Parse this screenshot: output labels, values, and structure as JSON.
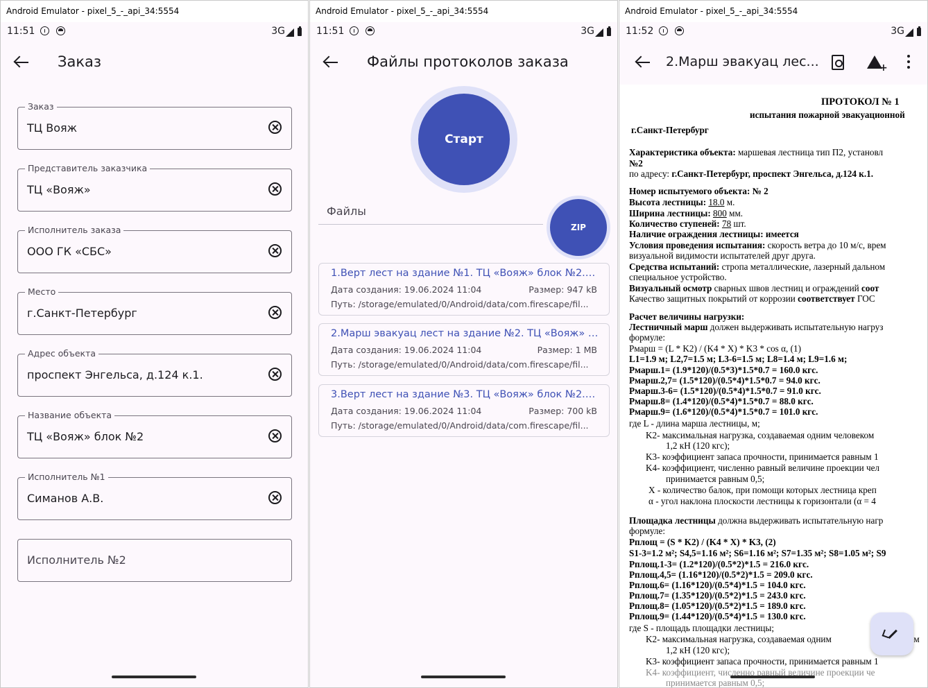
{
  "window_title": "Android Emulator - pixel_5_-_api_34:5554",
  "status": {
    "time_1": "11:51",
    "time_2": "11:51",
    "time_3": "11:52",
    "network": "3G"
  },
  "order_screen": {
    "title": "Заказ",
    "fields": [
      {
        "label": "Заказ",
        "value": "ТЦ Вояж"
      },
      {
        "label": "Представитель заказчика",
        "value": "ТЦ «Вояж»"
      },
      {
        "label": "Исполнитель заказа",
        "value": "ООО ГК «СБС»"
      },
      {
        "label": "Место",
        "value": "г.Санкт-Петербург"
      },
      {
        "label": "Адрес объекта",
        "value": "проспект Энгельса, д.124 к.1."
      },
      {
        "label": "Название объекта",
        "value": "ТЦ «Вояж» блок №2"
      },
      {
        "label": "Исполнитель №1",
        "value": "Симанов А.В."
      }
    ],
    "empty_field_placeholder": "Исполнитель №2"
  },
  "files_screen": {
    "title": "Файлы протоколов заказа",
    "start_label": "Старт",
    "zip_label": "ZIP",
    "files_label": "Файлы",
    "files": [
      {
        "name": "1.Верт лест на здание №1. ТЦ «Вояж» блок №2.pdf",
        "date": "Дата создания: 19.06.2024 11:04",
        "size": "Размер: 947 kB",
        "path": "Путь: /storage/emulated/0/Android/data/com.firescape/fil..."
      },
      {
        "name": "2.Марш эвакуац лест на здание №2. ТЦ «Вояж» блок №2.pdf",
        "date": "Дата создания: 19.06.2024 11:04",
        "size": "Размер: 1 MB",
        "path": "Путь: /storage/emulated/0/Android/data/com.firescape/fil..."
      },
      {
        "name": "3.Верт лест на здание №3. ТЦ «Вояж» блок №2.pdf",
        "date": "Дата создания: 19.06.2024 11:04",
        "size": "Размер: 700 kB",
        "path": "Путь: /storage/emulated/0/Android/data/com.firescape/fil..."
      }
    ]
  },
  "viewer_screen": {
    "title": "2.Марш эвакуац лес...",
    "doc": {
      "h1": "ПРОТОКОЛ № 1",
      "h2": "испытания пожарной эвакуационной",
      "city": "г.Санкт-Петербург",
      "char_label": "Характеристика объекта:",
      "char_value": " маршевая лестница тип П2, установл",
      "char_no": "№2",
      "addr_label": "по адресу: ",
      "addr_value": "г.Санкт-Петербург, проспект Энгельса, д.124 к.1.",
      "num_label": "Номер испытуемого объекта: № 2",
      "height_label": "Высота лестницы: ",
      "height_value": "18.0",
      "height_unit": " м.",
      "width_label": "Ширина лестницы: ",
      "width_value": "800",
      "width_unit": " мм.",
      "steps_label": "Количество ступеней: ",
      "steps_value": "78",
      "steps_unit": " шт.",
      "fence": "Наличие ограждения лестницы: имеется",
      "cond_label": "Условия проведения испытания:",
      "cond_value": " скорость ветра до 10 м/с, врем",
      "cond_line2": "визуальной видимости испытателей друг друга.",
      "means_label": "Средства испытаний:",
      "means_value": " стропа металлические, лазерный дальном",
      "means_line2": "специальное устройство.",
      "visual_label": "Визуальный осмотр",
      "visual_value": " сварных швов лестниц и ограждений ",
      "visual_end": "соот",
      "quality": "Качество защитных покрытий от коррозии ",
      "quality_b": "соответствует",
      "quality_end": " ГОС",
      "calc_title": "Расчет величины нагрузки:",
      "march_label": "Лестничный марш",
      "march_value": " должен выдерживать испытательную нагруз",
      "formula_word": "формуле:",
      "f1": "Pмарш = (L * K2) / (K4 * X) * K3 * cos α,     (1)",
      "f1_vals": "L1=1.9 м; L2,7=1.5 м; L3-6=1.5 м; L8=1.4 м; L9=1.6 м;",
      "f1_r1": "Pмарш.1= (1.9*120)/(0.5*3)*1.5*0.7 = 160.0 кгс.",
      "f1_r2": "Pмарш.2,7= (1.5*120)/(0.5*4)*1.5*0.7 = 94.0 кгс.",
      "f1_r3": "Pмарш.3-6= (1.5*120)/(0.5*4)*1.5*0.7 = 91.0 кгс.",
      "f1_r4": "Pмарш.8= (1.4*120)/(0.5*4)*1.5*0.7 = 88.0 кгс.",
      "f1_r5": "Pмарш.9= (1.6*120)/(0.5*4)*1.5*0.7 = 101.0 кгс.",
      "w1": "где  L - длина марша лестницы, м;",
      "w2": "K2- максимальная нагрузка, создаваемая одним человеком",
      "w2b": "1,2 кН (120 кгс);",
      "w3": "K3- коэффициент запаса прочности, принимается равным 1",
      "w4": "K4- коэффициент, численно равный величине проекции чел",
      "w4b": "принимается равным 0,5;",
      "w5": "X - количество балок, при помощи которых лестница креп",
      "w6": "α  - угол наклона плоскости лестницы к горизонтали (α = 4",
      "plat_label": "Площадка лестницы",
      "plat_value": " должна выдерживать испытательную нагр",
      "formula_word2": "формуле:",
      "f2": "Pплощ = (S * K2) / (K4 * X) * K3,     (2)",
      "f2_vals": "S1-3=1.2 м²; S4,5=1.16 м²; S6=1.16 м²; S7=1.35 м²; S8=1.05 м²; S9",
      "f2_r1": "Pплощ.1-3= (1.2*120)/(0.5*2)*1.5 = 216.0 кгс.",
      "f2_r2": "Pплощ.4,5= (1.16*120)/(0.5*2)*1.5 = 209.0 кгс.",
      "f2_r3": "Pплощ.6= (1.16*120)/(0.5*4)*1.5 = 104.0 кгс.",
      "f2_r4": "Pплощ.7= (1.35*120)/(0.5*2)*1.5 = 243.0 кгс.",
      "f2_r5": "Pплощ.8= (1.05*120)/(0.5*2)*1.5 = 189.0 кгс.",
      "f2_r6": "Pплощ.9= (1.44*120)/(0.5*4)*1.5 = 130.0 кгс.",
      "v1": "где  S - площадь площадки лестницы;",
      "v2": "K2- максимальная нагрузка, создаваемая одним",
      "v2_end": "ом",
      "v2b": "1,2 кН (120 кгс);",
      "v3": "K3- коэффициент запаса прочности, принимается равным 1",
      "v4": "K4- коэффициент, численно равный величине проекции че",
      "v4b": "принимается равным 0,5;"
    }
  },
  "colors": {
    "primary": "#3f51b5",
    "link": "#3f51b5",
    "surface": "#fdf8fd",
    "button_halo": "#dfe1f8"
  }
}
